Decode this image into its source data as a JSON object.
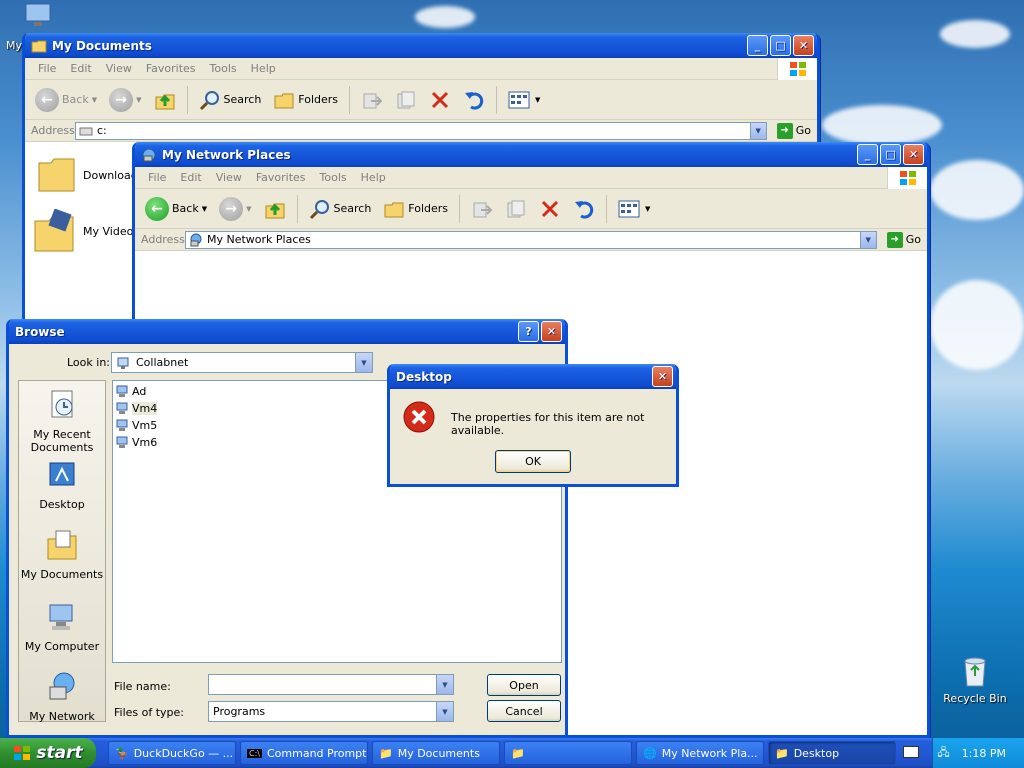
{
  "colors": {
    "title_blue": "#0a4fd8",
    "dialog_bg": "#ece9d8",
    "start_green": "#2f8f2f",
    "error_red": "#d42a1a"
  },
  "desktop": {
    "top_icon_label": "My",
    "recycle_bin_label": "Recycle Bin"
  },
  "mydocs": {
    "title": "My Documents",
    "menu": [
      "File",
      "Edit",
      "View",
      "Favorites",
      "Tools",
      "Help"
    ],
    "toolbar": {
      "back": "Back",
      "search": "Search",
      "folders": "Folders"
    },
    "address_label": "Address",
    "address_value": "c:",
    "go": "Go",
    "items": [
      "Downloads",
      "My Videos"
    ]
  },
  "netplaces": {
    "title": "My Network Places",
    "menu": [
      "File",
      "Edit",
      "View",
      "Favorites",
      "Tools",
      "Help"
    ],
    "toolbar": {
      "back": "Back",
      "search": "Search",
      "folders": "Folders"
    },
    "address_label": "Address",
    "address_value": "My Network Places",
    "go": "Go"
  },
  "browse": {
    "title": "Browse",
    "look_in_label": "Look in:",
    "look_in_value": "Collabnet",
    "places": [
      "My Recent Documents",
      "Desktop",
      "My Documents",
      "My Computer",
      "My Network"
    ],
    "files": [
      "Ad",
      "Vm4",
      "Vm5",
      "Vm6"
    ],
    "file_name_label": "File name:",
    "file_name_value": "",
    "files_of_type_label": "Files of type:",
    "files_of_type_value": "Programs",
    "open": "Open",
    "cancel": "Cancel"
  },
  "error": {
    "title": "Desktop",
    "message": "The properties for this item are not available.",
    "ok": "OK"
  },
  "taskbar": {
    "start": "start",
    "tasks": [
      "DuckDuckGo — ...",
      "Command Prompt",
      "My Documents",
      "",
      "My Network Pla...",
      "Desktop"
    ],
    "clock": "1:18 PM"
  }
}
